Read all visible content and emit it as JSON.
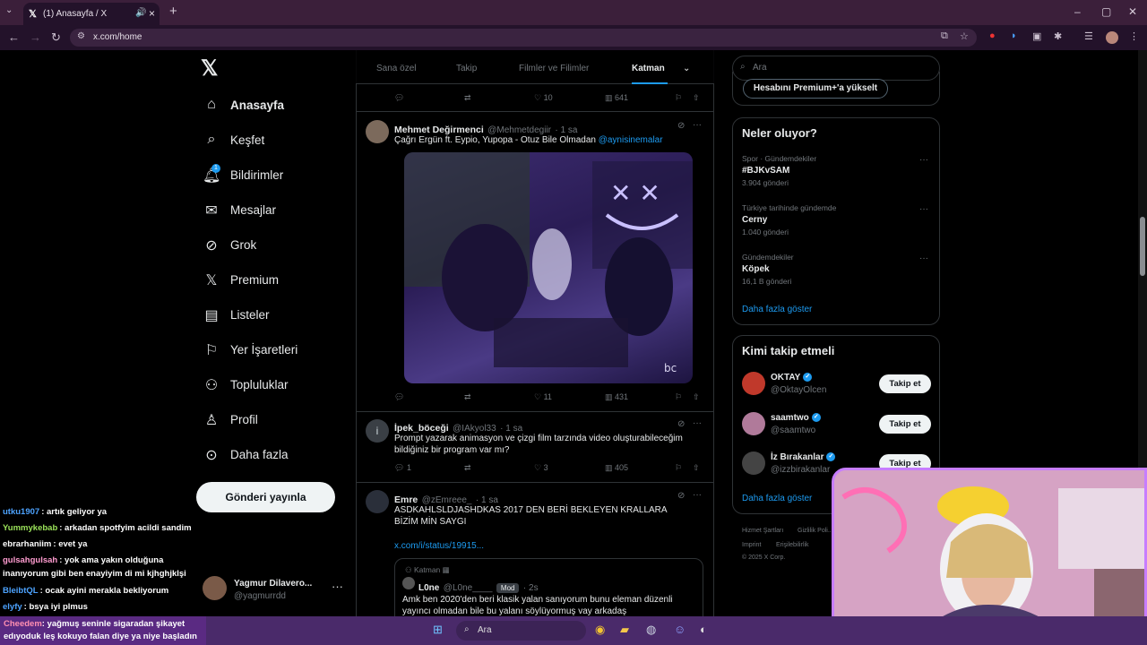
{
  "browser": {
    "tab_title": "(1) Anasayfa / X",
    "url": "x.com/home"
  },
  "nav": {
    "items": [
      {
        "label": "Anasayfa",
        "icon": "home-icon"
      },
      {
        "label": "Keşfet",
        "icon": "search-icon"
      },
      {
        "label": "Bildirimler",
        "icon": "bell-icon",
        "badge": "1"
      },
      {
        "label": "Mesajlar",
        "icon": "mail-icon"
      },
      {
        "label": "Grok",
        "icon": "grok-icon"
      },
      {
        "label": "Premium",
        "icon": "x-icon"
      },
      {
        "label": "Listeler",
        "icon": "list-icon"
      },
      {
        "label": "Yer İşaretleri",
        "icon": "bookmark-icon"
      },
      {
        "label": "Topluluklar",
        "icon": "people-icon"
      },
      {
        "label": "Profil",
        "icon": "user-icon"
      },
      {
        "label": "Daha fazla",
        "icon": "more-circle-icon"
      }
    ],
    "post_button": "Gönderi yayınla",
    "account": {
      "name": "Yagmur Dilavero...",
      "handle": "@yagmurrdd"
    }
  },
  "feed": {
    "tabs": [
      "Sana özel",
      "Takip",
      "Filmler ve Filimler",
      "Katman"
    ],
    "top_actions": {
      "likes": "10",
      "views": "641"
    },
    "posts": [
      {
        "name": "Mehmet Değirmenci",
        "handle": "@Mehmetdegiir",
        "time": "· 1 sa",
        "text": "Çağrı Ergün ft. Eypio, Yupopa - Otuz Bile Olmadan",
        "mention": "@aynisinemalar",
        "likes": "11",
        "views": "431"
      },
      {
        "name": "İpek_böceği",
        "handle": "@IAkyol33",
        "time": "· 1 sa",
        "text": "Prompt yazarak animasyon ve çizgi film tarzında video oluşturabileceğim bildiğiniz bir program var mı?",
        "replies": "1",
        "likes": "3",
        "views": "405"
      },
      {
        "name": "Emre",
        "handle": "@zEmreee_",
        "time": "· 1 sa",
        "text": "ASDKAHLSLDJASHDKAS 2017 DEN BERİ BEKLEYEN KRALLARA BİZİM MİN SAYGI",
        "link": "x.com/i/status/19915...",
        "quote": {
          "community": "Katman",
          "name": "L0ne",
          "handle": "@L0ne____",
          "badge": "Mod",
          "time": "· 2s",
          "text": "Amk ben 2020'den beri klasik yalan sanıyorum bunu eleman düzenli yayıncı olmadan bile bu yalanı söylüyormuş vay arkadaş"
        }
      }
    ]
  },
  "right": {
    "search_placeholder": "Ara",
    "premium_button": "Hesabını Premium+'a yükselt",
    "trends_title": "Neler oluyor?",
    "trends": [
      {
        "category": "Spor · Gündemdekiler",
        "name": "#BJKvSAM",
        "count": "3.904 gönderi"
      },
      {
        "category": "Türkiye tarihinde gündemde",
        "name": "Cerny",
        "count": "1.040 gönderi"
      },
      {
        "category": "Gündemdekiler",
        "name": "Köpek",
        "count": "16,1 B gönderi"
      }
    ],
    "trends_more": "Daha fazla göster",
    "who_title": "Kimi takip etmeli",
    "who": [
      {
        "name": "OKTAY",
        "handle": "@OktayOlcen",
        "button": "Takip et"
      },
      {
        "name": "saamtwo",
        "handle": "@saamtwo",
        "button": "Takip et"
      },
      {
        "name": "İz Bırakanlar",
        "handle": "@izzbirakanlar",
        "button": "Takip et"
      }
    ],
    "who_more": "Daha fazla göster",
    "footer": [
      "Hizmet Şartları",
      "Gizlilik Poli...",
      "Imprint",
      "Erişilebilirlik",
      "© 2025 X Corp."
    ]
  },
  "chat": [
    {
      "user": "utku1907",
      "msg": ": artık geliyor ya",
      "color": "#4da3ff"
    },
    {
      "user": "Yummykebab",
      "msg": ": arkadan spotfyim acildi sandim",
      "color": "#9be35a"
    },
    {
      "user": "ebrarhaniim",
      "msg": ": evet ya",
      "color": "#ffffff"
    },
    {
      "user": "gulsahgulsah",
      "msg": ": yok ama yakın olduğuna",
      "color": "#ff9cd0"
    },
    {
      "user": "",
      "msg": "inanıyorum gibi ben enayiyim di mi kjhghjklşi",
      "color": "#ffffff"
    },
    {
      "user": "BleibtQL",
      "msg": ": ocak ayini merakla bekliyorum",
      "color": "#4da3ff"
    },
    {
      "user": "elyfy",
      "msg": ": bsya iyi plmus",
      "color": "#4da3ff"
    }
  ],
  "chat_highlight": {
    "user": "Cheedem",
    "msg": ": yağmuş seninle sigaradan şikayet edıyoduk leş kokuyo falan diye ya niye başladın"
  },
  "taskbar": {
    "search": "Ara"
  }
}
